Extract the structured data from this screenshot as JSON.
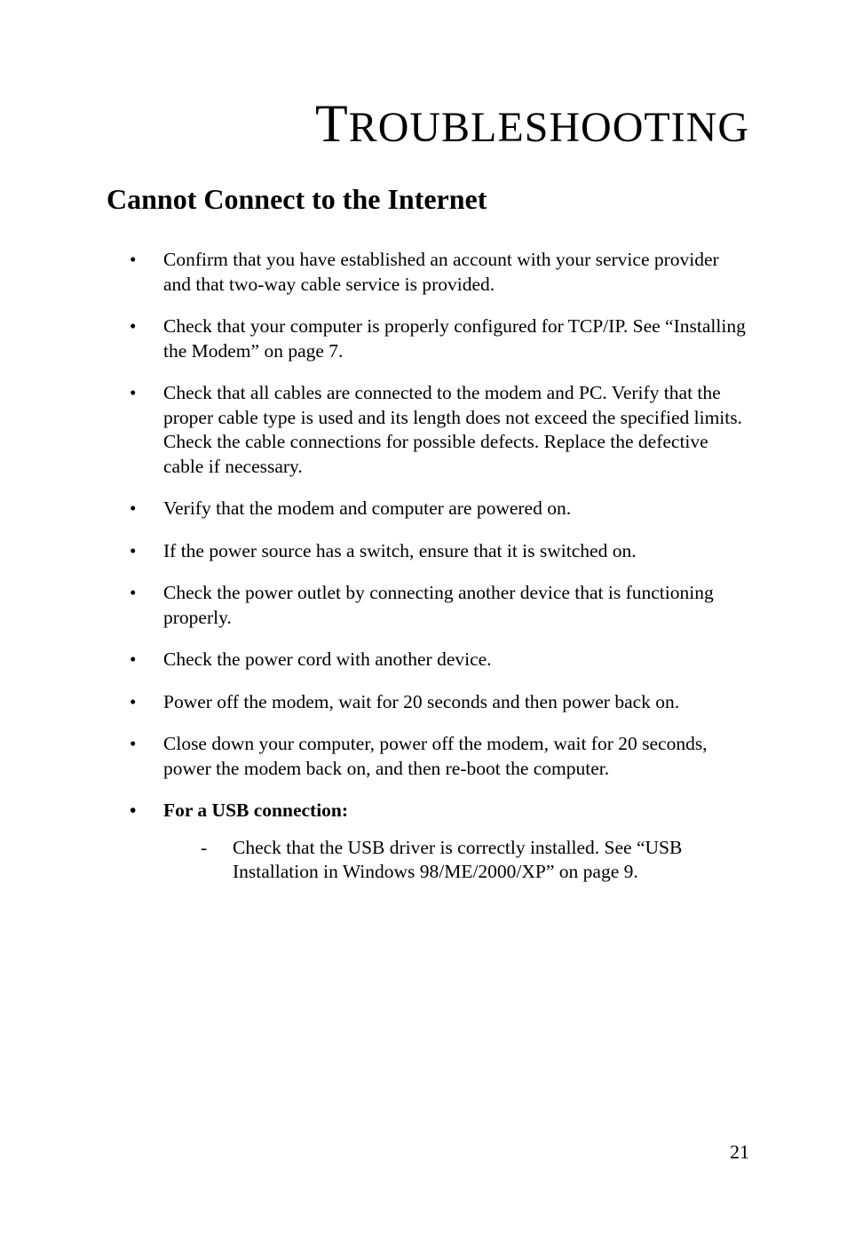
{
  "chapter": {
    "title_first_letter": "T",
    "title_rest": "ROUBLESHOOTING"
  },
  "section": {
    "heading": "Cannot Connect to the Internet"
  },
  "bullets": {
    "b0": "Confirm that you have established an account with your service provider and that two-way cable service is provided.",
    "b1": "Check that your computer is properly configured for TCP/IP. See “Installing the Modem” on page 7.",
    "b2": "Check that all cables are connected to the modem and PC. Verify that the proper cable type is used and its length does not exceed the specified limits. Check the cable connections for possible defects. Replace the defective cable if necessary.",
    "b3": "Verify that the modem and computer are powered on.",
    "b4": "If the power source has a switch, ensure that it is switched on.",
    "b5": "Check the power outlet by connecting another device that is functioning properly.",
    "b6": "Check the power cord with another device.",
    "b7": "Power off the modem, wait for 20 seconds and then power back on.",
    "b8": "Close down your computer, power off the modem, wait for 20 seconds, power the modem back on, and then re-boot the computer.",
    "b9": "For a USB connection:",
    "sub0": "Check that the USB driver is correctly installed. See “USB Installation in Windows 98/ME/2000/XP” on page 9."
  },
  "page_number": "21"
}
